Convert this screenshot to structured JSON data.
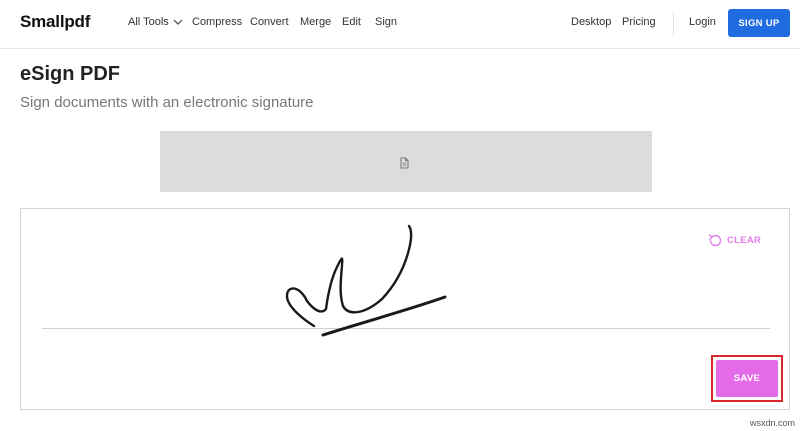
{
  "nav": {
    "logo": "Smallpdf",
    "all_tools": "All Tools",
    "compress": "Compress",
    "convert": "Convert",
    "merge": "Merge",
    "edit": "Edit",
    "sign": "Sign",
    "desktop": "Desktop",
    "pricing": "Pricing",
    "login": "Login",
    "signup": "SIGN UP"
  },
  "page": {
    "title": "eSign PDF",
    "subtitle": "Sign documents with an electronic signature"
  },
  "signature_pad": {
    "clear_label": "CLEAR",
    "save_label": "SAVE"
  },
  "watermark": "wsxdn.com",
  "colors": {
    "accent_pink": "#e36be8",
    "primary_blue": "#1f6be0",
    "highlight_red": "#d8262b"
  },
  "icons": {
    "all_tools_dropdown": "chevron-down-icon",
    "document_placeholder": "document-icon",
    "clear": "undo-icon"
  }
}
